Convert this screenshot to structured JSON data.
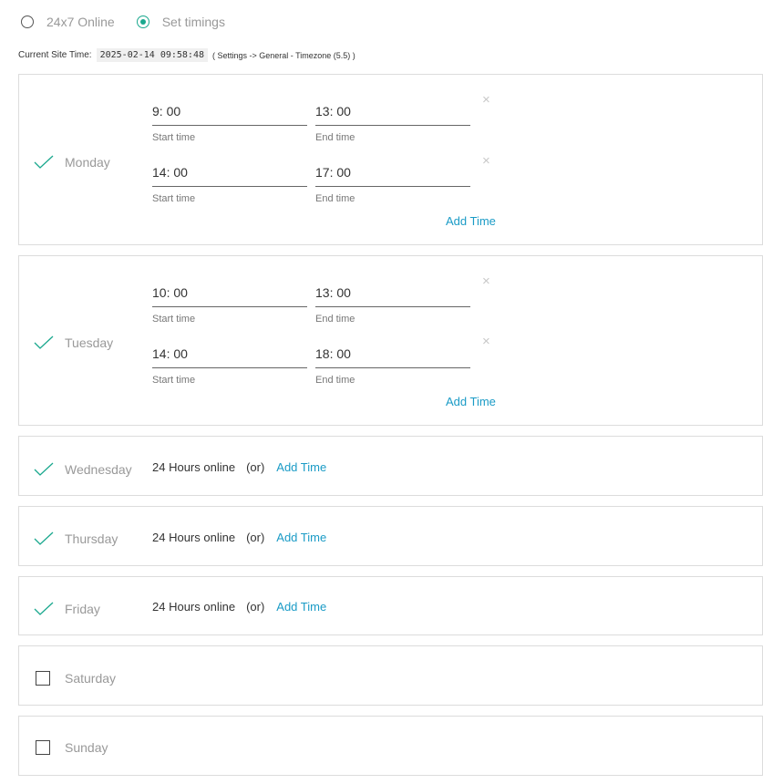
{
  "mode": {
    "option_24x7": "24x7 Online",
    "option_set": "Set timings",
    "selected": "set"
  },
  "site_time": {
    "label": "Current Site Time:",
    "value": "2025-02-14 09:58:48",
    "note": "( Settings -> General - Timezone (5.5) )"
  },
  "labels": {
    "start_time": "Start time",
    "end_time": "End time",
    "add_time": "Add Time",
    "hours_online": "24 Hours online",
    "or": "(or)",
    "remove": "×"
  },
  "colors": {
    "accent": "#1aa88e",
    "link": "#1a9bc6"
  },
  "days": [
    {
      "name": "Monday",
      "enabled": true,
      "slots": [
        {
          "start": "9: 00",
          "end": "13: 00"
        },
        {
          "start": "14: 00",
          "end": "17: 00"
        }
      ]
    },
    {
      "name": "Tuesday",
      "enabled": true,
      "slots": [
        {
          "start": "10: 00",
          "end": "13: 00"
        },
        {
          "start": "14: 00",
          "end": "18: 00"
        }
      ]
    },
    {
      "name": "Wednesday",
      "enabled": true,
      "slots": []
    },
    {
      "name": "Thursday",
      "enabled": true,
      "slots": []
    },
    {
      "name": "Friday",
      "enabled": true,
      "slots": []
    },
    {
      "name": "Saturday",
      "enabled": false,
      "slots": []
    },
    {
      "name": "Sunday",
      "enabled": false,
      "slots": []
    }
  ]
}
